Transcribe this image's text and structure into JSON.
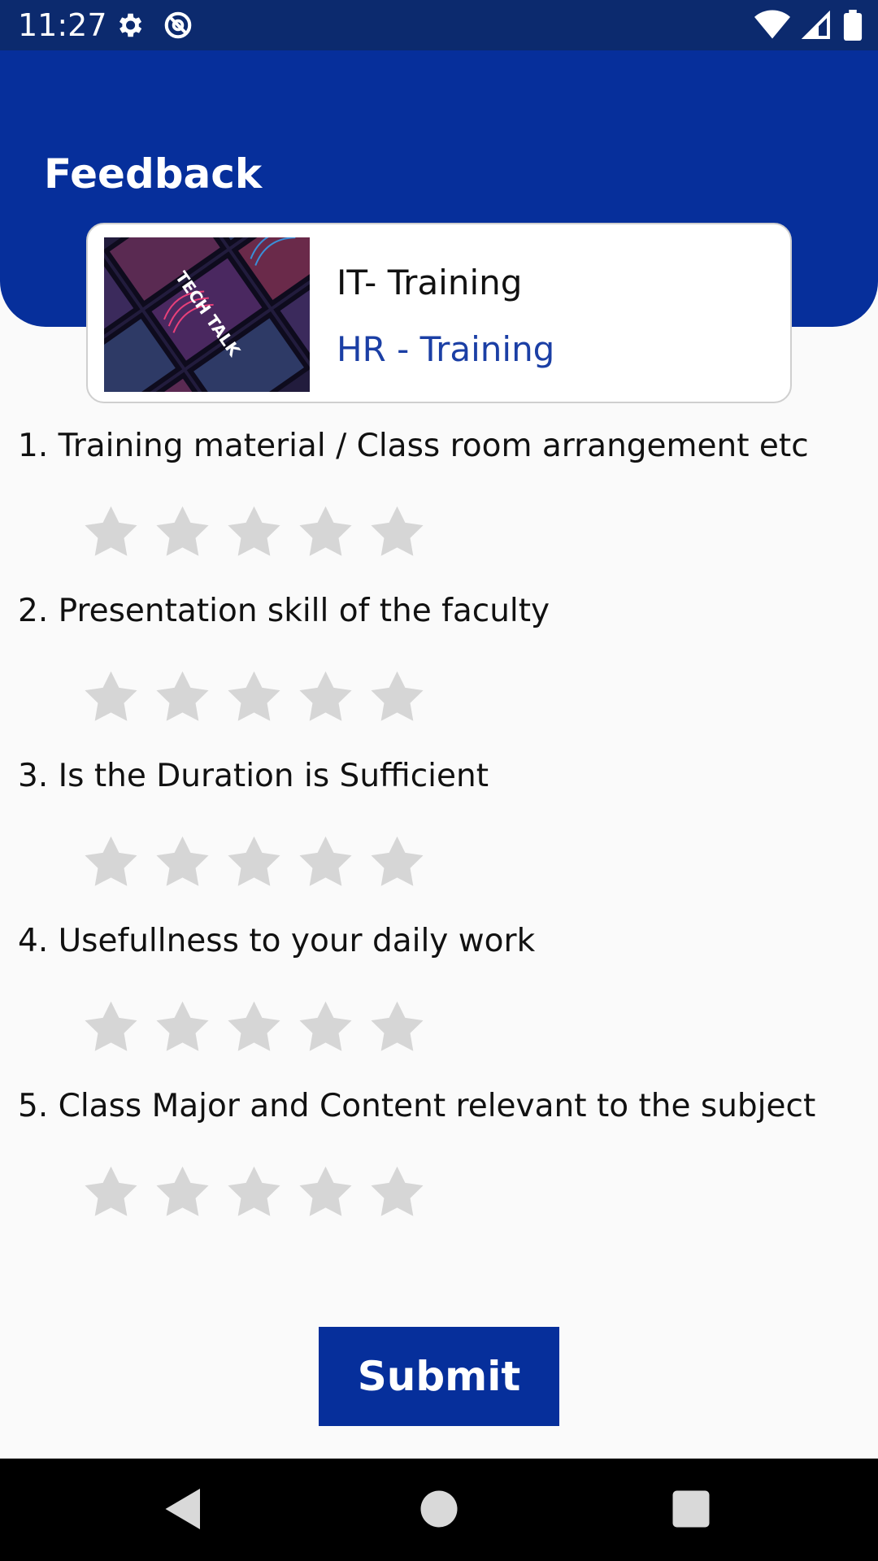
{
  "status_bar": {
    "time": "11:27",
    "left_icons": [
      "settings-icon",
      "at-sign-icon"
    ],
    "right_icons": [
      "wifi-icon",
      "cellular-signal-icon",
      "battery-icon"
    ]
  },
  "header": {
    "title": "Feedback"
  },
  "course": {
    "name": "IT- Training",
    "department": "HR - Training",
    "thumbnail_text": "TECH TALK"
  },
  "questions": [
    {
      "label": "1. Training material / Class room arrangement etc",
      "rating": 0,
      "max_rating": 5
    },
    {
      "label": "2. Presentation skill of the faculty",
      "rating": 0,
      "max_rating": 5
    },
    {
      "label": "3. Is the Duration is Sufficient",
      "rating": 0,
      "max_rating": 5
    },
    {
      "label": "4. Usefullness to your daily work",
      "rating": 0,
      "max_rating": 5
    },
    {
      "label": "5. Class Major and Content relevant to the subject",
      "rating": 0,
      "max_rating": 5
    }
  ],
  "submit_label": "Submit",
  "nav_bar": [
    "back-icon",
    "home-icon",
    "recents-icon"
  ],
  "colors": {
    "primary": "#062f9b",
    "status_bar": "#0c2a6e",
    "link": "#1b3fa5",
    "star_empty": "#d6d6d6",
    "background": "#fafafa"
  }
}
